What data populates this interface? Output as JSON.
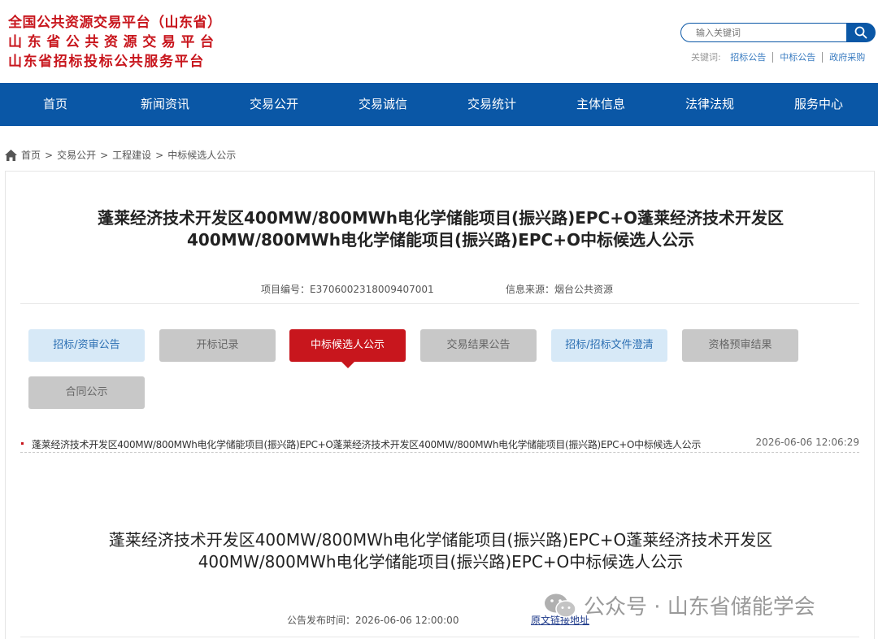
{
  "header": {
    "logo_lines": [
      "全国公共资源交易平台（山东省）",
      "山东省公共资源交易平台",
      "山东省招标投标公共服务平台"
    ],
    "search_placeholder": "输入关键词",
    "keywords_label": "关键词:",
    "keywords": [
      "招标公告",
      "中标公告",
      "政府采购"
    ]
  },
  "nav": [
    "首页",
    "新闻资讯",
    "交易公开",
    "交易诚信",
    "交易统计",
    "主体信息",
    "法律法规",
    "服务中心"
  ],
  "breadcrumb": [
    "首页",
    "交易公开",
    "工程建设",
    "中标候选人公示"
  ],
  "notice": {
    "title_line1": "蓬莱经济技术开发区400MW/800MWh电化学储能项目(振兴路)EPC+O蓬莱经济技术开发区",
    "title_line2": "400MW/800MWh电化学储能项目(振兴路)EPC+O中标候选人公示",
    "project_code": "项目编号：E3706002318009407001",
    "source": "信息来源：烟台公共资源"
  },
  "tabs": [
    {
      "label": "招标/资审公告",
      "style": "blue"
    },
    {
      "label": "开标记录",
      "style": "gray"
    },
    {
      "label": "中标候选人公示",
      "style": "red"
    },
    {
      "label": "交易结果公告",
      "style": "gray"
    },
    {
      "label": "招标/招标文件澄清",
      "style": "blue"
    },
    {
      "label": "资格预审结果",
      "style": "gray"
    },
    {
      "label": "合同公示",
      "style": "gray"
    }
  ],
  "list": [
    {
      "title": "蓬莱经济技术开发区400MW/800MWh电化学储能项目(振兴路)EPC+O蓬莱经济技术开发区400MW/800MWh电化学储能项目(振兴路)EPC+O中标候选人公示",
      "time": "2026-06-06 12:06:29"
    }
  ],
  "article": {
    "title_line1": "蓬莱经济技术开发区400MW/800MWh电化学储能项目(振兴路)EPC+O蓬莱经济技术开发区",
    "title_line2": "400MW/800MWh电化学储能项目(振兴路)EPC+O中标候选人公示",
    "publish_time": "公告发布时间：2026-06-06 12:00:00",
    "origin_link": "原文链接地址"
  },
  "watermark": "公众号 · 山东省储能学会",
  "colors": {
    "brand_red": "#c8161d",
    "nav_blue": "#0a57a6"
  }
}
